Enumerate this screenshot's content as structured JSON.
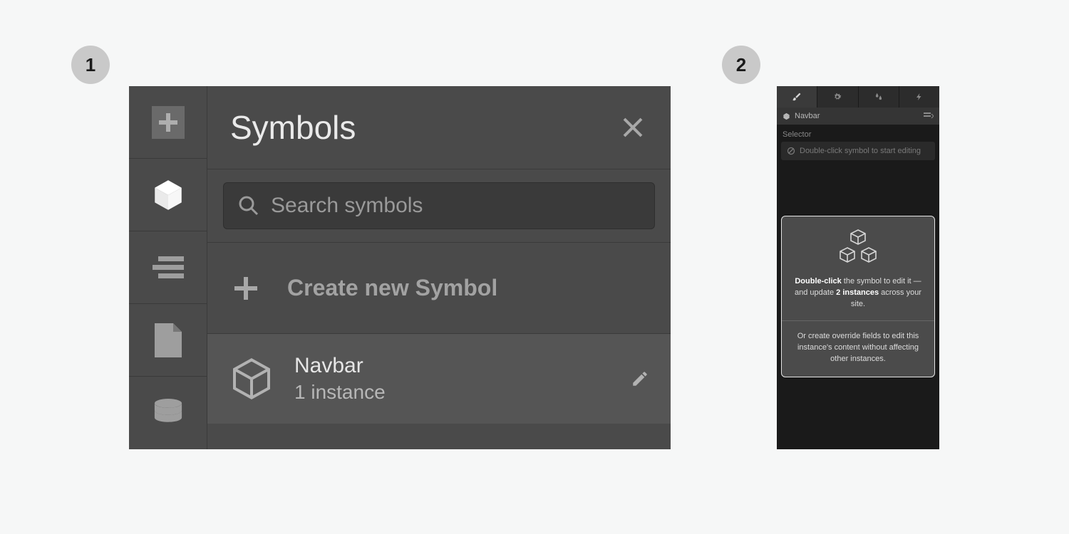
{
  "badges": {
    "one": "1",
    "two": "2"
  },
  "panel1": {
    "title": "Symbols",
    "search_placeholder": "Search symbols",
    "create_label": "Create new Symbol",
    "symbol": {
      "name": "Navbar",
      "count": "1 instance"
    }
  },
  "panel2": {
    "breadcrumb_name": "Navbar",
    "selector_label": "Selector",
    "selector_hint": "Double-click symbol to start editing",
    "info": {
      "line1_strong": "Double-click",
      "line1_rest": " the symbol to edit it — and update ",
      "line1_strong2": "2 instances",
      "line1_rest2": " across your site.",
      "line2": "Or create override fields to edit this instance's content without affecting other instances."
    }
  }
}
